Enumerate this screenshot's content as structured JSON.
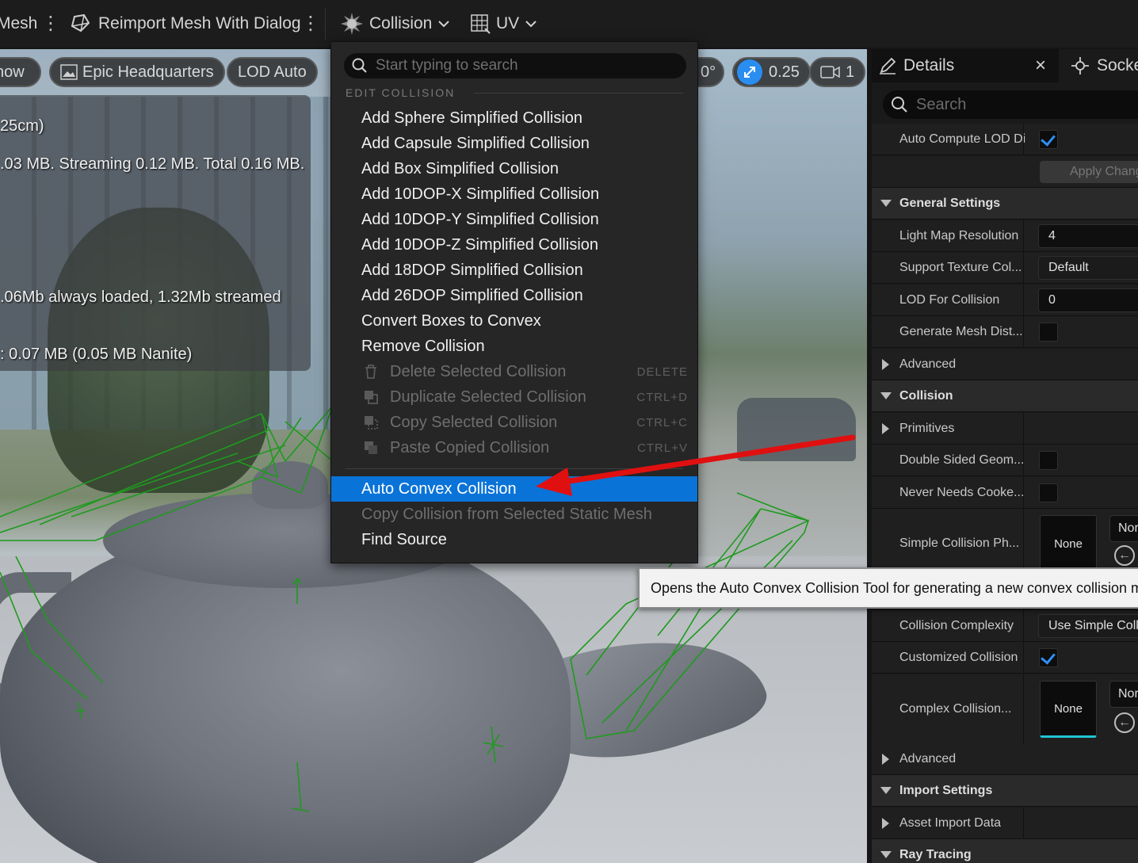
{
  "toolbar": {
    "mesh_label": "Mesh",
    "reimport_label": "Reimport Mesh With Dialog",
    "collision_label": "Collision",
    "uv_label": "UV"
  },
  "viewport": {
    "show_label": "how",
    "environment_label": "Epic Headquarters",
    "lod_label": "LOD Auto",
    "rotation_snap": "0°",
    "scale_snap": "0.25",
    "camera_speed": "1",
    "stats": [
      "25cm)",
      ".03 MB. Streaming 0.12 MB. Total 0.16 MB.",
      ".06Mb always loaded, 1.32Mb streamed",
      ": 0.07 MB (0.05 MB Nanite)"
    ]
  },
  "menu": {
    "search_placeholder": "Start typing to search",
    "section": "EDIT COLLISION",
    "items": [
      "Add Sphere Simplified Collision",
      "Add Capsule Simplified Collision",
      "Add Box Simplified Collision",
      "Add 10DOP-X Simplified Collision",
      "Add 10DOP-Y Simplified Collision",
      "Add 10DOP-Z Simplified Collision",
      "Add 18DOP Simplified Collision",
      "Add 26DOP Simplified Collision",
      "Convert Boxes to Convex",
      "Remove Collision"
    ],
    "disabled_items": [
      {
        "label": "Delete Selected Collision",
        "shortcut": "DELETE"
      },
      {
        "label": "Duplicate Selected Collision",
        "shortcut": "CTRL+D"
      },
      {
        "label": "Copy Selected Collision",
        "shortcut": "CTRL+C"
      },
      {
        "label": "Paste Copied Collision",
        "shortcut": "CTRL+V"
      }
    ],
    "auto_convex": "Auto Convex Collision",
    "copy_from_static": "Copy Collision from Selected Static Mesh",
    "find_source": "Find Source"
  },
  "tooltip": "Opens the Auto Convex Collision Tool for generating a new convex collision me",
  "details": {
    "tab_details": "Details",
    "tab_sockets": "Socke",
    "search_placeholder": "Search",
    "auto_compute_lod": "Auto Compute LOD Di",
    "apply_changes": "Apply Chang",
    "general_settings": "General Settings",
    "light_map_resolution": {
      "label": "Light Map Resolution",
      "value": "4"
    },
    "support_texture": {
      "label": "Support Texture Col...",
      "value": "Default"
    },
    "lod_for_collision": {
      "label": "LOD For Collision",
      "value": "0"
    },
    "generate_mesh_dist": "Generate Mesh Dist...",
    "advanced": "Advanced",
    "collision": "Collision",
    "primitives": "Primitives",
    "double_sided": "Double Sided Geom...",
    "never_needs_cooked": "Never Needs Cooke...",
    "simple_collision_ph": "Simple Collision Ph...",
    "none": "None",
    "none_short": "Nor",
    "collision_complexity": {
      "label": "Collision Complexity",
      "value": "Use Simple Colli"
    },
    "customized_collision": "Customized Collision",
    "complex_collision": "Complex Collision...",
    "advanced2": "Advanced",
    "import_settings": "Import Settings",
    "asset_import_data": "Asset Import Data",
    "ray_tracing": "Ray Tracing"
  },
  "colors": {
    "highlight": "#0a73d8",
    "checkbox": "#2f8ff5",
    "arrow": "#e01010",
    "wire": "#1f9a1f"
  }
}
